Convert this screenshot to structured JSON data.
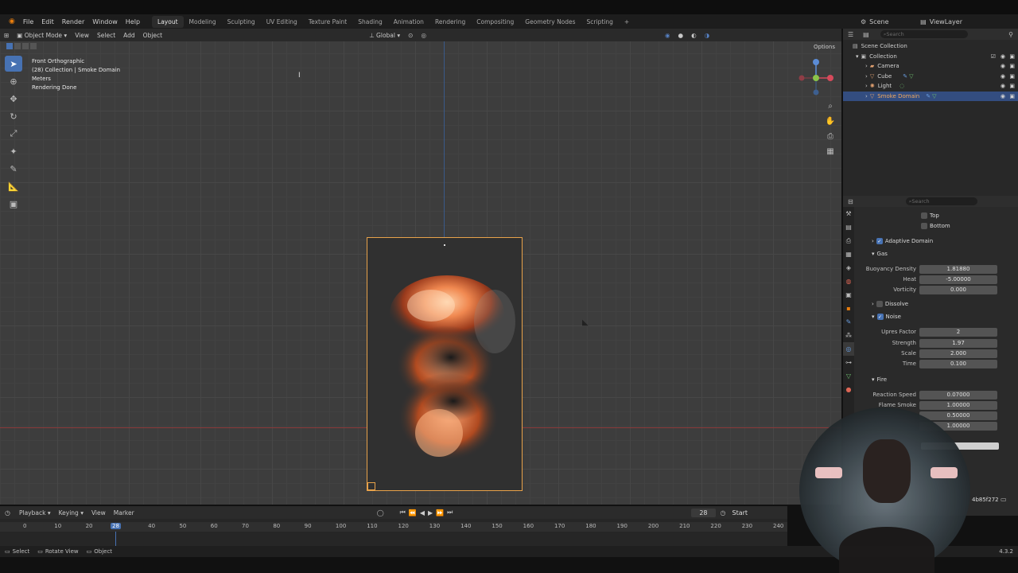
{
  "menu": [
    "File",
    "Edit",
    "Render",
    "Window",
    "Help"
  ],
  "workspace_tabs": [
    "Layout",
    "Modeling",
    "Sculpting",
    "UV Editing",
    "Texture Paint",
    "Shading",
    "Animation",
    "Rendering",
    "Compositing",
    "Geometry Nodes",
    "Scripting",
    "+"
  ],
  "scene": {
    "scene_label": "Scene",
    "viewlayer_label": "ViewLayer"
  },
  "viewport_header": {
    "mode": "Object Mode",
    "view": "View",
    "select": "Select",
    "add": "Add",
    "object": "Object",
    "orientation": "Global",
    "options": "Options"
  },
  "viewport_info": {
    "line1": "Front Orthographic",
    "line2": "(28) Collection | Smoke Domain",
    "line3": "Meters",
    "line4": "Rendering Done"
  },
  "outliner": {
    "search_placeholder": "Search",
    "root": "Scene Collection",
    "collection": "Collection",
    "items": [
      "Camera",
      "Cube",
      "Light",
      "Smoke Domain"
    ]
  },
  "properties": {
    "search_placeholder": "Search",
    "top_items": [
      "Top",
      "Bottom"
    ],
    "adaptive_domain": "Adaptive Domain",
    "gas_section": "Gas",
    "buoyancy_density_label": "Buoyancy Density",
    "buoyancy_density": "1.81880",
    "heat_label": "Heat",
    "heat": "-5.00000",
    "vorticity_label": "Vorticity",
    "vorticity": "0.000",
    "dissolve": "Dissolve",
    "noise": "Noise",
    "upres_label": "Upres Factor",
    "upres": "2",
    "strength_label": "Strength",
    "strength": "1.97",
    "scale_label": "Scale",
    "scale": "2.000",
    "time_label": "Time",
    "time": "0.100",
    "fire_section": "Fire",
    "reaction_speed_label": "Reaction Speed",
    "reaction_speed": "0.07000",
    "flame_smoke_label": "Flame Smoke",
    "flame_smoke": "1.00000",
    "field3": "0.50000",
    "field4": "1.00000",
    "hash_label": "4b85f272"
  },
  "timeline": {
    "playback": "Playback",
    "keying": "Keying",
    "view": "View",
    "marker": "Marker",
    "current_frame": "28",
    "start_label": "Start",
    "ticks": [
      "0",
      "10",
      "20",
      "28",
      "40",
      "50",
      "60",
      "70",
      "80",
      "90",
      "100",
      "110",
      "120",
      "130",
      "140",
      "150",
      "160",
      "170",
      "180",
      "190",
      "200",
      "210",
      "220",
      "230",
      "240"
    ]
  },
  "status": {
    "select": "Select",
    "rotate": "Rotate View",
    "object": "Object",
    "version": "4.3.2"
  }
}
